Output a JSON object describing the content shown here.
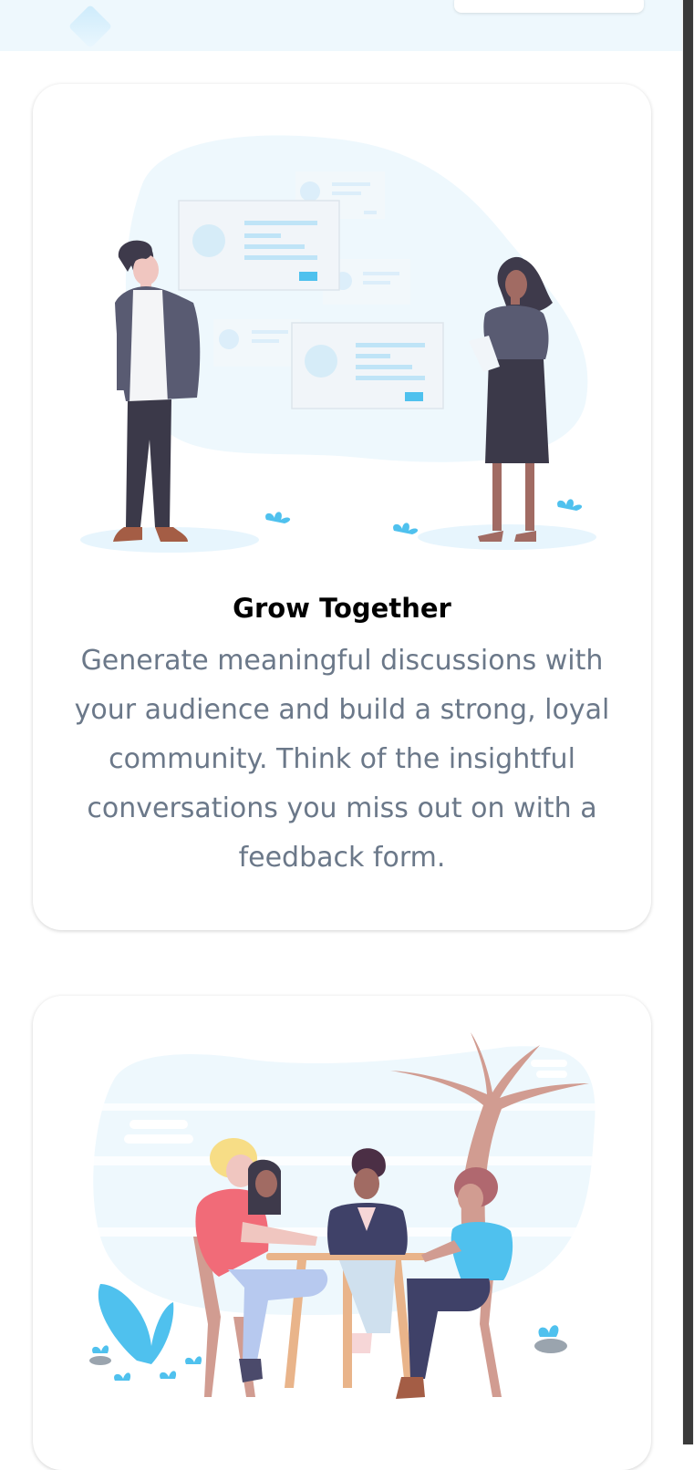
{
  "features": [
    {
      "title": "Grow Together",
      "description": "Generate meaningful discussions with your audience and build a strong, loyal community. Think of the insightful conversations you miss out on with a feedback form."
    },
    {
      "title": "",
      "description": ""
    }
  ],
  "colors": {
    "top_band": "#eef8fd",
    "card_bg": "#ffffff",
    "title": "#000000",
    "body_text": "#6b7889",
    "accent": "#4fc1ee"
  },
  "icons": [
    "diamond-logo-icon",
    "people-presenting-illustration",
    "people-at-table-illustration"
  ]
}
